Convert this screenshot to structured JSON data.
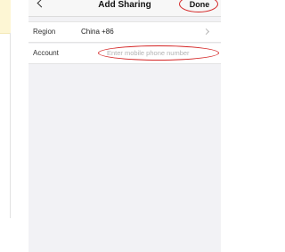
{
  "header": {
    "back_icon": "chevron-left-icon",
    "title": "Add Sharing",
    "done_label": "Done"
  },
  "form": {
    "region": {
      "label": "Region",
      "value": "China +86",
      "chevron_icon": "chevron-right-icon"
    },
    "account": {
      "label": "Account",
      "placeholder": "Enter mobile phone number",
      "value": ""
    }
  },
  "colors": {
    "annotation_circle": "#d42424",
    "left_accent": "#fdf6d4",
    "panel_background": "#f2f2f5"
  }
}
